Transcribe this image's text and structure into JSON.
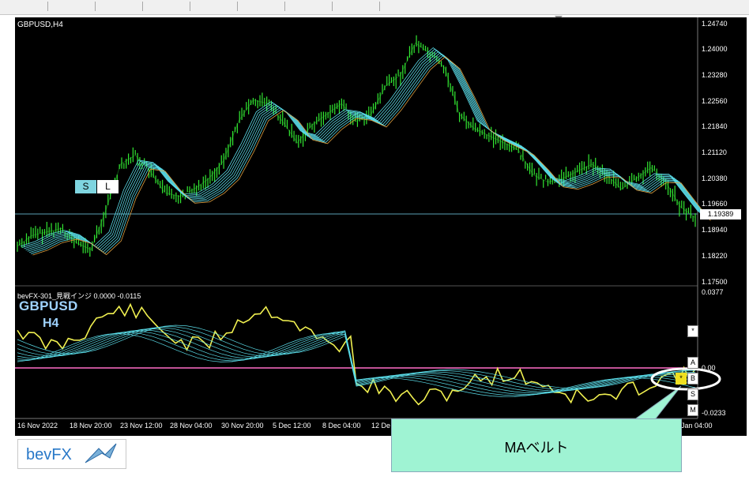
{
  "chart": {
    "title": "GBPUSD,H4",
    "symbol": "GBPUSD",
    "timeframe": "H4",
    "indicator_title": "bevFX-301_見戦インジ 0.0000 -0.0115",
    "buttons": {
      "s": "S",
      "l": "L",
      "star": "*",
      "a": "A",
      "b": "B",
      "small_s": "S",
      "m": "M",
      "marker": "*"
    },
    "price_tag": "1.19389",
    "price_axis": [
      "1.24740",
      "1.24000",
      "1.23280",
      "1.22560",
      "1.21840",
      "1.21120",
      "1.20380",
      "1.19660",
      "1.18940",
      "1.18220",
      "1.17500"
    ],
    "indicator_axis": [
      "0.0377",
      "0.00",
      "-0.0233"
    ],
    "date_axis": [
      "16 Nov 2022",
      "18 Nov 20:00",
      "23 Nov 12:00",
      "28 Nov 04:00",
      "30 Nov 20:00",
      "5 Dec 12:00",
      "8 Dec 04:00",
      "12 De",
      "Jan 04:00"
    ]
  },
  "callout": {
    "text": "MAベルト"
  },
  "logo": {
    "text": "bevFX"
  },
  "colors": {
    "background": "#000000",
    "candle": "#32e632",
    "ma_belt": "#5adce8",
    "signal_line": "#f0f050",
    "zero_line": "#ff6ec8",
    "callout_fill": "#9ff3d3"
  },
  "chart_data": {
    "type": "line",
    "series": [
      {
        "name": "GBPUSD,H4",
        "values": [
          1.185,
          1.188,
          1.189,
          1.19,
          1.186,
          1.184,
          1.195,
          1.208,
          1.2105,
          1.206,
          1.2,
          1.199,
          1.201,
          1.204,
          1.209,
          1.22,
          1.226,
          1.225,
          1.22,
          1.214,
          1.219,
          1.222,
          1.225,
          1.22,
          1.222,
          1.23,
          1.233,
          1.242,
          1.239,
          1.235,
          1.222,
          1.218,
          1.216,
          1.214,
          1.212,
          1.205,
          1.203,
          1.204,
          1.206,
          1.208,
          1.205,
          1.201,
          1.204,
          1.207,
          1.203,
          1.196,
          1.193
        ]
      }
    ],
    "ylim": [
      1.175,
      1.2474
    ]
  }
}
